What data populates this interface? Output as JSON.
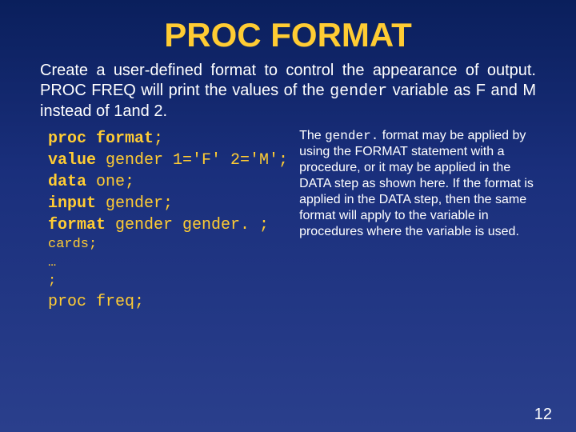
{
  "title": "PROC FORMAT",
  "intro_part1": "Create a user-defined format to control the appearance of output. PROC FREQ will print the values of the ",
  "intro_code": "gender",
  "intro_part2": " variable as F and M instead of 1and 2.",
  "code": {
    "l1a": "proc format",
    "l1b": ";",
    "l2a": "   ",
    "l2b": "value",
    "l2c": " gender 1='F' 2='M';",
    "l3a": "data",
    "l3b": " one;",
    "l4a": "   ",
    "l4b": "input",
    "l4c": " gender;",
    "l5a": "   ",
    "l5b": "format",
    "l5c": " gender gender. ;",
    "l6": "cards;",
    "l7": "…",
    "l8": ";",
    "l9": "proc freq;"
  },
  "note_pre": "The ",
  "note_code": "gender.",
  "note_post": " format may be applied by using the FORMAT statement with a procedure, or it may be applied in the DATA step as shown here. If the format is applied in the DATA step, then the same format will apply to the variable in procedures where the variable is used.",
  "pagenum": "12"
}
